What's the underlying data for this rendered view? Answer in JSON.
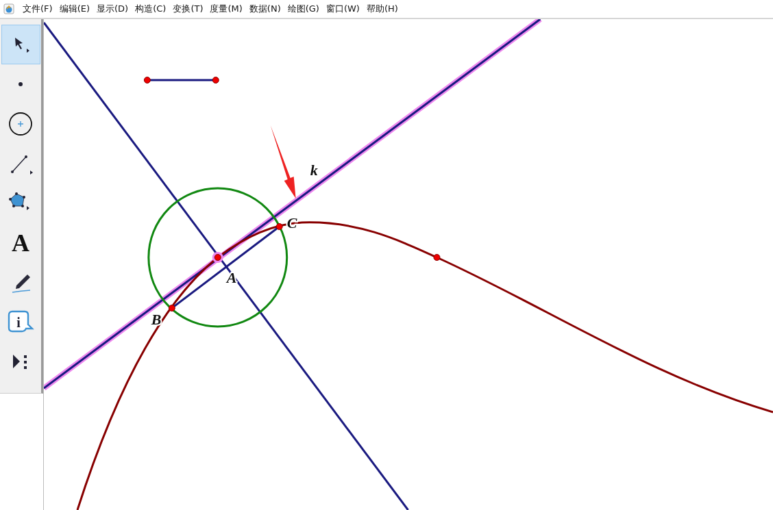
{
  "menu": [
    "文件(F)",
    "编辑(E)",
    "显示(D)",
    "构造(C)",
    "变换(T)",
    "度量(M)",
    "数据(N)",
    "绘图(G)",
    "窗口(W)",
    "帮助(H)"
  ],
  "tools": [
    {
      "kind": "arrow",
      "selected": true
    },
    {
      "kind": "point",
      "selected": false
    },
    {
      "kind": "compass",
      "selected": false
    },
    {
      "kind": "straightedge",
      "selected": false
    },
    {
      "kind": "polygon",
      "selected": false
    },
    {
      "kind": "text",
      "glyph": "A",
      "selected": false
    },
    {
      "kind": "marker",
      "selected": false
    },
    {
      "kind": "info",
      "glyph": "i",
      "selected": false
    },
    {
      "kind": "custom",
      "selected": false
    }
  ],
  "points": [
    {
      "label": "A",
      "selected": true
    },
    {
      "label": "B",
      "selected": false
    },
    {
      "label": "C",
      "selected": false
    }
  ],
  "lines": [
    {
      "label": "k",
      "selected": true
    }
  ]
}
